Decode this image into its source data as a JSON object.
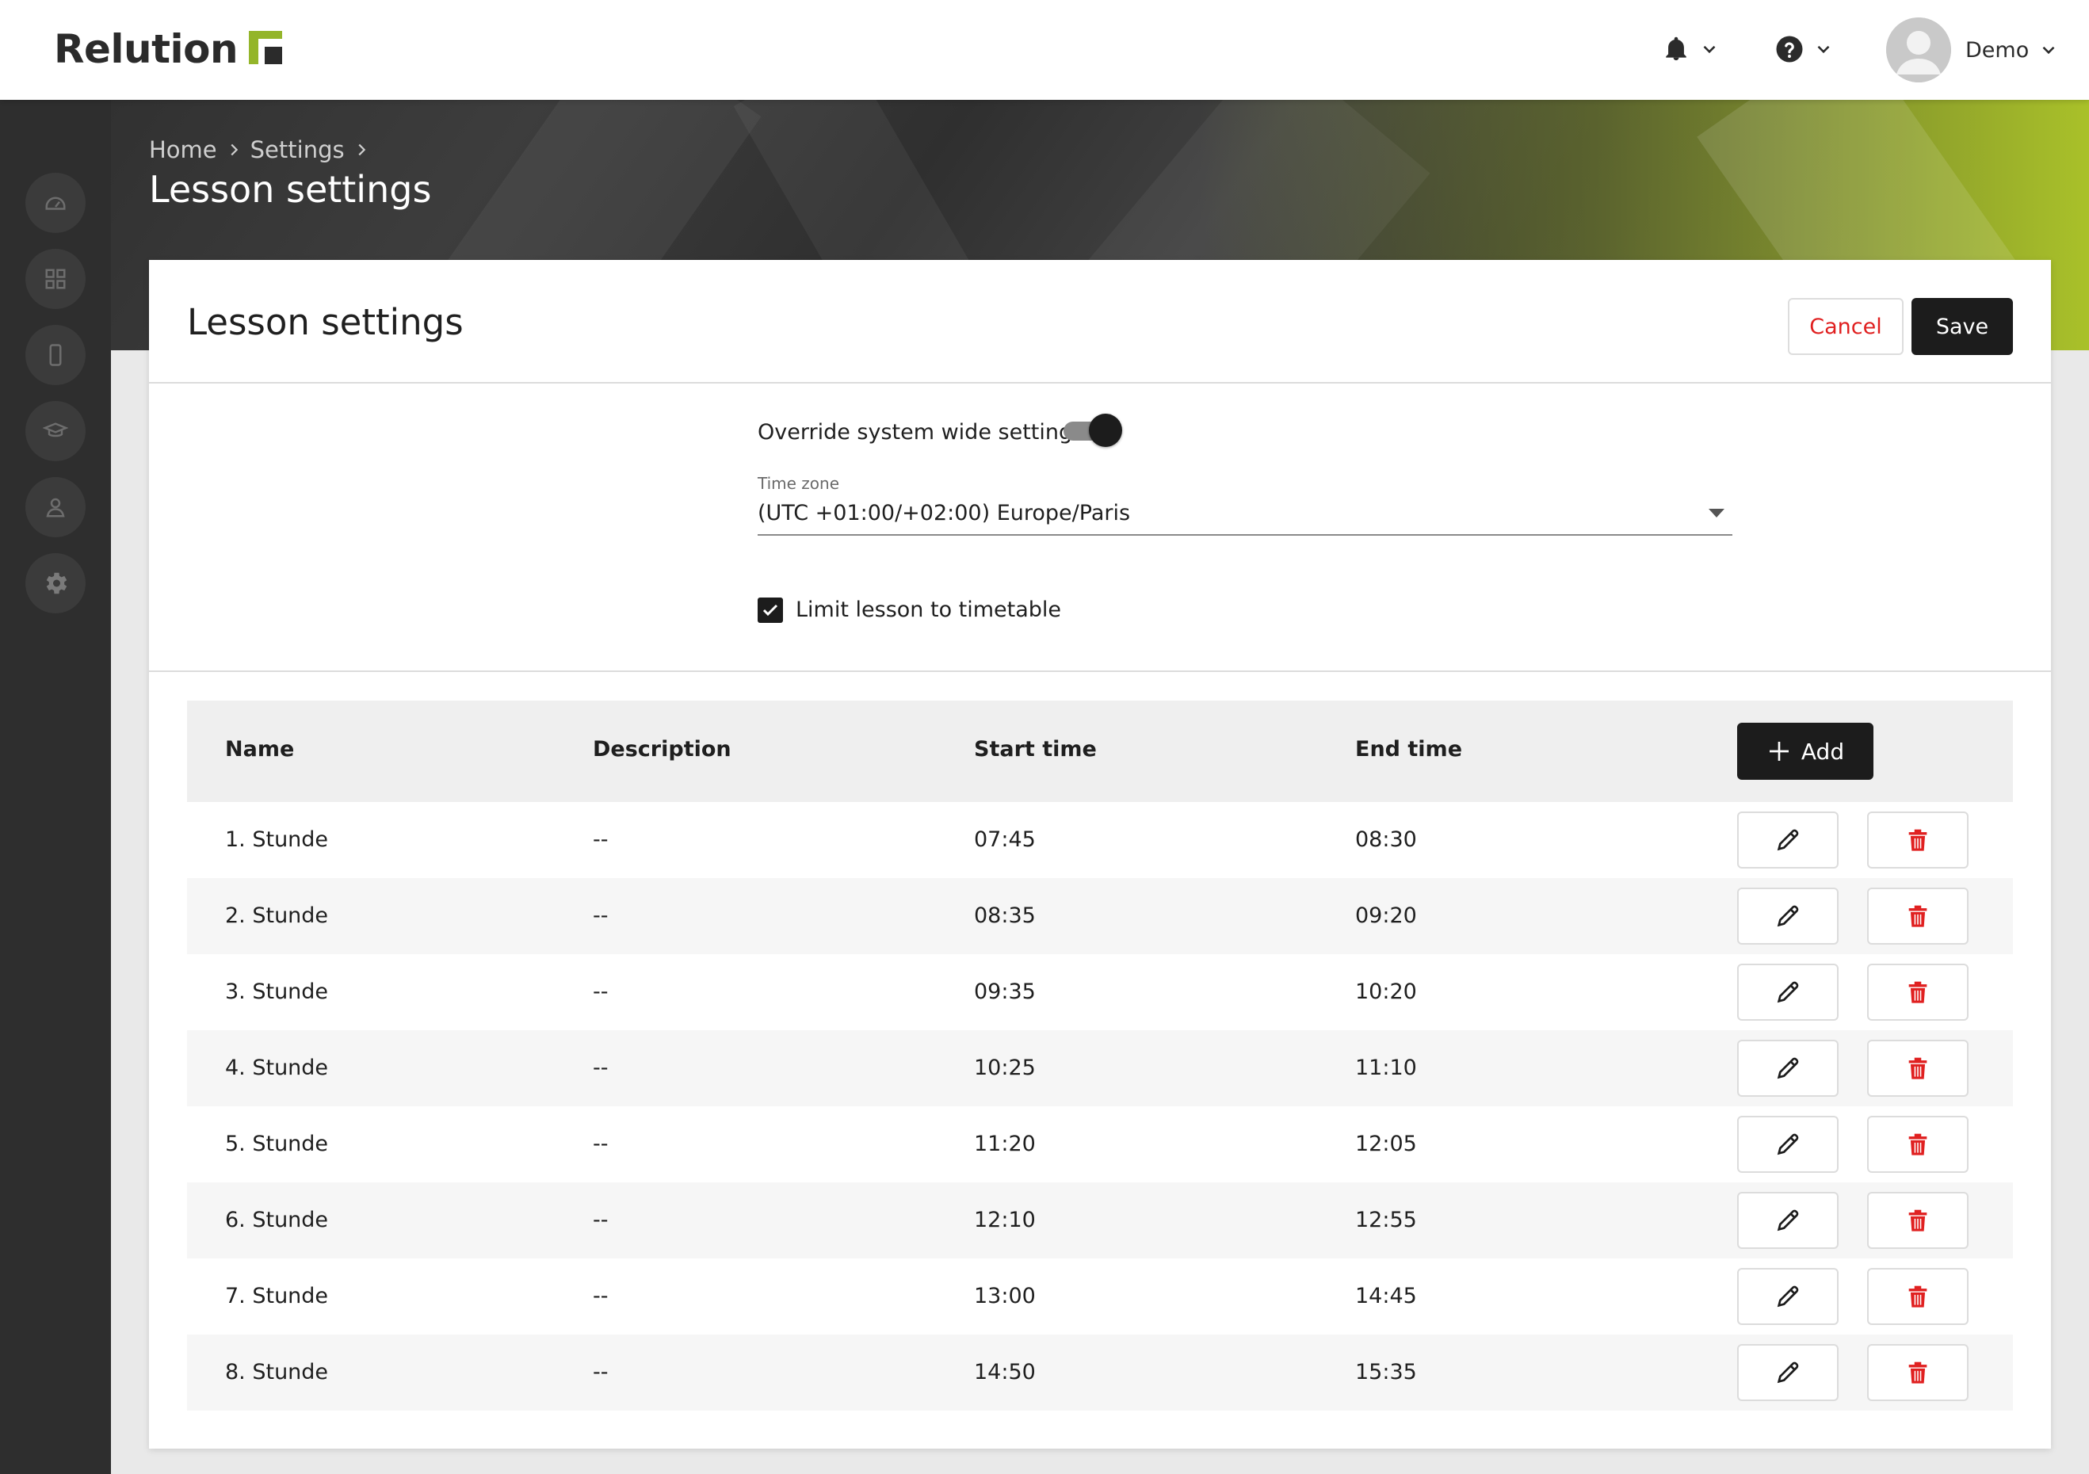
{
  "app": {
    "logo_text": "Relution",
    "brand_color": "#94b52a",
    "user_name": "Demo"
  },
  "topbar": {
    "icons": [
      "bell-icon",
      "help-icon",
      "user-avatar"
    ]
  },
  "sidebar": {
    "items": [
      {
        "name": "dashboard",
        "icon": "speedometer-icon"
      },
      {
        "name": "apps",
        "icon": "grid-icon"
      },
      {
        "name": "devices",
        "icon": "smartphone-icon"
      },
      {
        "name": "education",
        "icon": "graduation-cap-icon"
      },
      {
        "name": "users",
        "icon": "user-icon"
      },
      {
        "name": "settings",
        "icon": "gear-icon"
      }
    ]
  },
  "breadcrumb": {
    "items": [
      "Home",
      "Settings"
    ]
  },
  "page": {
    "title": "Lesson settings"
  },
  "card": {
    "title": "Lesson settings",
    "cancel_label": "Cancel",
    "save_label": "Save"
  },
  "settings": {
    "override_label": "Override system wide settings",
    "override_enabled": true,
    "timezone_label": "Time zone",
    "timezone_value": "(UTC +01:00/+02:00) Europe/Paris",
    "limit_label": "Limit lesson to timetable",
    "limit_checked": true
  },
  "table": {
    "headers": {
      "name": "Name",
      "description": "Description",
      "start": "Start time",
      "end": "End time"
    },
    "add_label": "Add",
    "rows": [
      {
        "name": "1. Stunde",
        "description": "--",
        "start": "07:45",
        "end": "08:30"
      },
      {
        "name": "2. Stunde",
        "description": "--",
        "start": "08:35",
        "end": "09:20"
      },
      {
        "name": "3. Stunde",
        "description": "--",
        "start": "09:35",
        "end": "10:20"
      },
      {
        "name": "4. Stunde",
        "description": "--",
        "start": "10:25",
        "end": "11:10"
      },
      {
        "name": "5. Stunde",
        "description": "--",
        "start": "11:20",
        "end": "12:05"
      },
      {
        "name": "6. Stunde",
        "description": "--",
        "start": "12:10",
        "end": "12:55"
      },
      {
        "name": "7. Stunde",
        "description": "--",
        "start": "13:00",
        "end": "14:45"
      },
      {
        "name": "8. Stunde",
        "description": "--",
        "start": "14:50",
        "end": "15:35"
      }
    ]
  },
  "colors": {
    "danger": "#e02020",
    "dark": "#1c1c1c"
  }
}
